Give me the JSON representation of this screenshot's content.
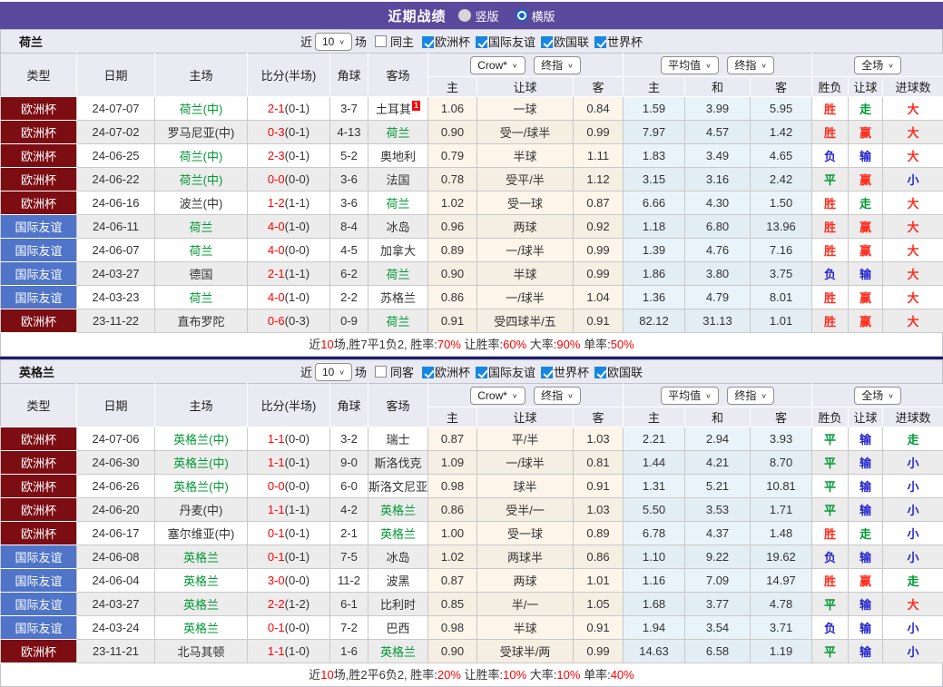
{
  "title_bar": {
    "title": "近期战绩",
    "radios": [
      {
        "label": "竖版",
        "selected": false
      },
      {
        "label": "横版",
        "selected": true
      }
    ]
  },
  "table_labels": {
    "type": "类型",
    "date": "日期",
    "home": "主场",
    "score": "比分(半场)",
    "corner": "角球",
    "away": "客场",
    "sub": [
      "主",
      "让球",
      "客",
      "主",
      "和",
      "客",
      "胜负",
      "让球",
      "进球数"
    ],
    "dropdowns": {
      "book": "Crow*",
      "fin1": "终指",
      "avg": "平均值",
      "fin2": "终指",
      "scope": "全场"
    }
  },
  "colors": {
    "topbar": "#5a4a9d",
    "euro_cup": "#7c0d12",
    "friendly": "#4f74c8",
    "team_green": "#009933",
    "win_red": "#ff2d1f",
    "lose_blue": "#2525cf",
    "odds_cream": "#fdf5ea",
    "avg_blue": "#e9f4fa"
  },
  "sections": [
    {
      "team": "荷兰",
      "filter": {
        "near": "近",
        "count": "10",
        "games": "场",
        "same": "同主",
        "same_checked": false,
        "leagues": [
          {
            "label": "欧洲杯",
            "checked": true
          },
          {
            "label": "国际友谊",
            "checked": true
          },
          {
            "label": "欧国联",
            "checked": true
          },
          {
            "label": "世界杯",
            "checked": true
          }
        ]
      },
      "rows": [
        {
          "type": "欧洲杯",
          "type_style": "red",
          "date": "24-07-07",
          "home": "荷兰(中)",
          "home_green": true,
          "score": "2-1",
          "half": "(0-1)",
          "corner": "3-7",
          "away": "土耳其",
          "away_green": false,
          "badge": "1",
          "crow_home": "1.06",
          "handicap": "一球",
          "crow_away": "0.84",
          "avg_home": "1.59",
          "avg_draw": "3.99",
          "avg_away": "5.95",
          "wdl": "胜",
          "wdl_c": "red",
          "cover": "走",
          "cover_c": "green",
          "ou": "大",
          "ou_c": "red"
        },
        {
          "type": "欧洲杯",
          "type_style": "red",
          "date": "24-07-02",
          "home": "罗马尼亚(中)",
          "home_green": false,
          "score": "0-3",
          "half": "(0-1)",
          "corner": "4-13",
          "away": "荷兰",
          "away_green": true,
          "badge": "",
          "crow_home": "0.90",
          "handicap": "受一/球半",
          "crow_away": "0.99",
          "avg_home": "7.97",
          "avg_draw": "4.57",
          "avg_away": "1.42",
          "wdl": "胜",
          "wdl_c": "red",
          "cover": "赢",
          "cover_c": "red",
          "ou": "大",
          "ou_c": "red"
        },
        {
          "type": "欧洲杯",
          "type_style": "red",
          "date": "24-06-25",
          "home": "荷兰(中)",
          "home_green": true,
          "score": "2-3",
          "half": "(0-1)",
          "corner": "5-2",
          "away": "奥地利",
          "away_green": false,
          "badge": "",
          "crow_home": "0.79",
          "handicap": "半球",
          "crow_away": "1.11",
          "avg_home": "1.83",
          "avg_draw": "3.49",
          "avg_away": "4.65",
          "wdl": "负",
          "wdl_c": "blue",
          "cover": "输",
          "cover_c": "blue",
          "ou": "大",
          "ou_c": "red"
        },
        {
          "type": "欧洲杯",
          "type_style": "red",
          "date": "24-06-22",
          "home": "荷兰(中)",
          "home_green": true,
          "score": "0-0",
          "half": "(0-0)",
          "corner": "3-6",
          "away": "法国",
          "away_green": false,
          "badge": "",
          "crow_home": "0.78",
          "handicap": "受平/半",
          "crow_away": "1.12",
          "avg_home": "3.15",
          "avg_draw": "3.16",
          "avg_away": "2.42",
          "wdl": "平",
          "wdl_c": "green",
          "cover": "赢",
          "cover_c": "red",
          "ou": "小",
          "ou_c": "blue"
        },
        {
          "type": "欧洲杯",
          "type_style": "red",
          "date": "24-06-16",
          "home": "波兰(中)",
          "home_green": false,
          "score": "1-2",
          "half": "(1-1)",
          "corner": "3-6",
          "away": "荷兰",
          "away_green": true,
          "badge": "",
          "crow_home": "1.02",
          "handicap": "受一球",
          "crow_away": "0.87",
          "avg_home": "6.66",
          "avg_draw": "4.30",
          "avg_away": "1.50",
          "wdl": "胜",
          "wdl_c": "red",
          "cover": "走",
          "cover_c": "green",
          "ou": "大",
          "ou_c": "red"
        },
        {
          "type": "国际友谊",
          "type_style": "blue",
          "date": "24-06-11",
          "home": "荷兰",
          "home_green": true,
          "score": "4-0",
          "half": "(1-0)",
          "corner": "8-4",
          "away": "冰岛",
          "away_green": false,
          "badge": "",
          "crow_home": "0.96",
          "handicap": "两球",
          "crow_away": "0.92",
          "avg_home": "1.18",
          "avg_draw": "6.80",
          "avg_away": "13.96",
          "wdl": "胜",
          "wdl_c": "red",
          "cover": "赢",
          "cover_c": "red",
          "ou": "大",
          "ou_c": "red"
        },
        {
          "type": "国际友谊",
          "type_style": "blue",
          "date": "24-06-07",
          "home": "荷兰",
          "home_green": true,
          "score": "4-0",
          "half": "(0-0)",
          "corner": "4-5",
          "away": "加拿大",
          "away_green": false,
          "badge": "",
          "crow_home": "0.89",
          "handicap": "一/球半",
          "crow_away": "0.99",
          "avg_home": "1.39",
          "avg_draw": "4.76",
          "avg_away": "7.16",
          "wdl": "胜",
          "wdl_c": "red",
          "cover": "赢",
          "cover_c": "red",
          "ou": "大",
          "ou_c": "red"
        },
        {
          "type": "国际友谊",
          "type_style": "blue",
          "date": "24-03-27",
          "home": "德国",
          "home_green": false,
          "score": "2-1",
          "half": "(1-1)",
          "corner": "6-2",
          "away": "荷兰",
          "away_green": true,
          "badge": "",
          "crow_home": "0.90",
          "handicap": "半球",
          "crow_away": "0.99",
          "avg_home": "1.86",
          "avg_draw": "3.80",
          "avg_away": "3.75",
          "wdl": "负",
          "wdl_c": "blue",
          "cover": "输",
          "cover_c": "blue",
          "ou": "大",
          "ou_c": "red"
        },
        {
          "type": "国际友谊",
          "type_style": "blue",
          "date": "24-03-23",
          "home": "荷兰",
          "home_green": true,
          "score": "4-0",
          "half": "(1-0)",
          "corner": "2-2",
          "away": "苏格兰",
          "away_green": false,
          "badge": "",
          "crow_home": "0.86",
          "handicap": "一/球半",
          "crow_away": "1.04",
          "avg_home": "1.36",
          "avg_draw": "4.79",
          "avg_away": "8.01",
          "wdl": "胜",
          "wdl_c": "red",
          "cover": "赢",
          "cover_c": "red",
          "ou": "大",
          "ou_c": "red"
        },
        {
          "type": "欧洲杯",
          "type_style": "red",
          "date": "23-11-22",
          "home": "直布罗陀",
          "home_green": false,
          "score": "0-6",
          "half": "(0-3)",
          "corner": "0-9",
          "away": "荷兰",
          "away_green": true,
          "badge": "",
          "crow_home": "0.91",
          "handicap": "受四球半/五",
          "crow_away": "0.91",
          "avg_home": "82.12",
          "avg_draw": "31.13",
          "avg_away": "1.01",
          "wdl": "胜",
          "wdl_c": "red",
          "cover": "赢",
          "cover_c": "red",
          "ou": "大",
          "ou_c": "red"
        }
      ],
      "summary": [
        [
          "近",
          false
        ],
        [
          "10",
          true
        ],
        [
          "场,胜7平1负2, 胜率:",
          false
        ],
        [
          "70%",
          true
        ],
        [
          " 让胜率:",
          false
        ],
        [
          "60%",
          true
        ],
        [
          " 大率:",
          false
        ],
        [
          "90%",
          true
        ],
        [
          " 单率:",
          false
        ],
        [
          "50%",
          true
        ]
      ]
    },
    {
      "team": "英格兰",
      "filter": {
        "near": "近",
        "count": "10",
        "games": "场",
        "same": "同客",
        "same_checked": false,
        "leagues": [
          {
            "label": "欧洲杯",
            "checked": true
          },
          {
            "label": "国际友谊",
            "checked": true
          },
          {
            "label": "世界杯",
            "checked": true
          },
          {
            "label": "欧国联",
            "checked": true
          }
        ]
      },
      "rows": [
        {
          "type": "欧洲杯",
          "type_style": "red",
          "date": "24-07-06",
          "home": "英格兰(中)",
          "home_green": true,
          "score": "1-1",
          "half": "(0-0)",
          "corner": "3-2",
          "away": "瑞士",
          "away_green": false,
          "badge": "",
          "crow_home": "0.87",
          "handicap": "平/半",
          "crow_away": "1.03",
          "avg_home": "2.21",
          "avg_draw": "2.94",
          "avg_away": "3.93",
          "wdl": "平",
          "wdl_c": "green",
          "cover": "输",
          "cover_c": "blue",
          "ou": "走",
          "ou_c": "green"
        },
        {
          "type": "欧洲杯",
          "type_style": "red",
          "date": "24-06-30",
          "home": "英格兰(中)",
          "home_green": true,
          "score": "1-1",
          "half": "(0-1)",
          "corner": "9-0",
          "away": "斯洛伐克",
          "away_green": false,
          "badge": "",
          "crow_home": "1.09",
          "handicap": "一/球半",
          "crow_away": "0.81",
          "avg_home": "1.44",
          "avg_draw": "4.21",
          "avg_away": "8.70",
          "wdl": "平",
          "wdl_c": "green",
          "cover": "输",
          "cover_c": "blue",
          "ou": "小",
          "ou_c": "blue"
        },
        {
          "type": "欧洲杯",
          "type_style": "red",
          "date": "24-06-26",
          "home": "英格兰(中)",
          "home_green": true,
          "score": "0-0",
          "half": "(0-0)",
          "corner": "6-0",
          "away": "斯洛文尼亚",
          "away_green": false,
          "badge": "",
          "crow_home": "0.98",
          "handicap": "球半",
          "crow_away": "0.91",
          "avg_home": "1.31",
          "avg_draw": "5.21",
          "avg_away": "10.81",
          "wdl": "平",
          "wdl_c": "green",
          "cover": "输",
          "cover_c": "blue",
          "ou": "小",
          "ou_c": "blue"
        },
        {
          "type": "欧洲杯",
          "type_style": "red",
          "date": "24-06-20",
          "home": "丹麦(中)",
          "home_green": false,
          "score": "1-1",
          "half": "(1-1)",
          "corner": "4-2",
          "away": "英格兰",
          "away_green": true,
          "badge": "",
          "crow_home": "0.86",
          "handicap": "受半/一",
          "crow_away": "1.03",
          "avg_home": "5.50",
          "avg_draw": "3.53",
          "avg_away": "1.71",
          "wdl": "平",
          "wdl_c": "green",
          "cover": "输",
          "cover_c": "blue",
          "ou": "小",
          "ou_c": "blue"
        },
        {
          "type": "欧洲杯",
          "type_style": "red",
          "date": "24-06-17",
          "home": "塞尔维亚(中)",
          "home_green": false,
          "score": "0-1",
          "half": "(0-1)",
          "corner": "2-1",
          "away": "英格兰",
          "away_green": true,
          "badge": "",
          "crow_home": "1.00",
          "handicap": "受一球",
          "crow_away": "0.89",
          "avg_home": "6.78",
          "avg_draw": "4.37",
          "avg_away": "1.48",
          "wdl": "胜",
          "wdl_c": "red",
          "cover": "走",
          "cover_c": "green",
          "ou": "小",
          "ou_c": "blue"
        },
        {
          "type": "国际友谊",
          "type_style": "blue",
          "date": "24-06-08",
          "home": "英格兰",
          "home_green": true,
          "score": "0-1",
          "half": "(0-1)",
          "corner": "7-5",
          "away": "冰岛",
          "away_green": false,
          "badge": "",
          "crow_home": "1.02",
          "handicap": "两球半",
          "crow_away": "0.86",
          "avg_home": "1.10",
          "avg_draw": "9.22",
          "avg_away": "19.62",
          "wdl": "负",
          "wdl_c": "blue",
          "cover": "输",
          "cover_c": "blue",
          "ou": "小",
          "ou_c": "blue"
        },
        {
          "type": "国际友谊",
          "type_style": "blue",
          "date": "24-06-04",
          "home": "英格兰",
          "home_green": true,
          "score": "3-0",
          "half": "(0-0)",
          "corner": "11-2",
          "away": "波黑",
          "away_green": false,
          "badge": "",
          "crow_home": "0.87",
          "handicap": "两球",
          "crow_away": "1.01",
          "avg_home": "1.16",
          "avg_draw": "7.09",
          "avg_away": "14.97",
          "wdl": "胜",
          "wdl_c": "red",
          "cover": "赢",
          "cover_c": "red",
          "ou": "走",
          "ou_c": "green"
        },
        {
          "type": "国际友谊",
          "type_style": "blue",
          "date": "24-03-27",
          "home": "英格兰",
          "home_green": true,
          "score": "2-2",
          "half": "(1-2)",
          "corner": "6-1",
          "away": "比利时",
          "away_green": false,
          "badge": "",
          "crow_home": "0.85",
          "handicap": "半/一",
          "crow_away": "1.05",
          "avg_home": "1.68",
          "avg_draw": "3.77",
          "avg_away": "4.78",
          "wdl": "平",
          "wdl_c": "green",
          "cover": "输",
          "cover_c": "blue",
          "ou": "大",
          "ou_c": "red"
        },
        {
          "type": "国际友谊",
          "type_style": "blue",
          "date": "24-03-24",
          "home": "英格兰",
          "home_green": true,
          "score": "0-1",
          "half": "(0-0)",
          "corner": "7-2",
          "away": "巴西",
          "away_green": false,
          "badge": "",
          "crow_home": "0.98",
          "handicap": "半球",
          "crow_away": "0.91",
          "avg_home": "1.94",
          "avg_draw": "3.54",
          "avg_away": "3.71",
          "wdl": "负",
          "wdl_c": "blue",
          "cover": "输",
          "cover_c": "blue",
          "ou": "小",
          "ou_c": "blue"
        },
        {
          "type": "欧洲杯",
          "type_style": "red",
          "date": "23-11-21",
          "home": "北马其顿",
          "home_green": false,
          "score": "1-1",
          "half": "(1-0)",
          "corner": "1-6",
          "away": "英格兰",
          "away_green": true,
          "badge": "",
          "crow_home": "0.90",
          "handicap": "受球半/两",
          "crow_away": "0.99",
          "avg_home": "14.63",
          "avg_draw": "6.58",
          "avg_away": "1.19",
          "wdl": "平",
          "wdl_c": "green",
          "cover": "输",
          "cover_c": "blue",
          "ou": "小",
          "ou_c": "blue"
        }
      ],
      "summary": [
        [
          "近",
          false
        ],
        [
          "10",
          true
        ],
        [
          "场,胜2平6负2, 胜率:",
          false
        ],
        [
          "20%",
          true
        ],
        [
          " 让胜率:",
          false
        ],
        [
          "10%",
          true
        ],
        [
          " 大率:",
          false
        ],
        [
          "10%",
          true
        ],
        [
          " 单率:",
          false
        ],
        [
          "40%",
          true
        ]
      ]
    }
  ]
}
